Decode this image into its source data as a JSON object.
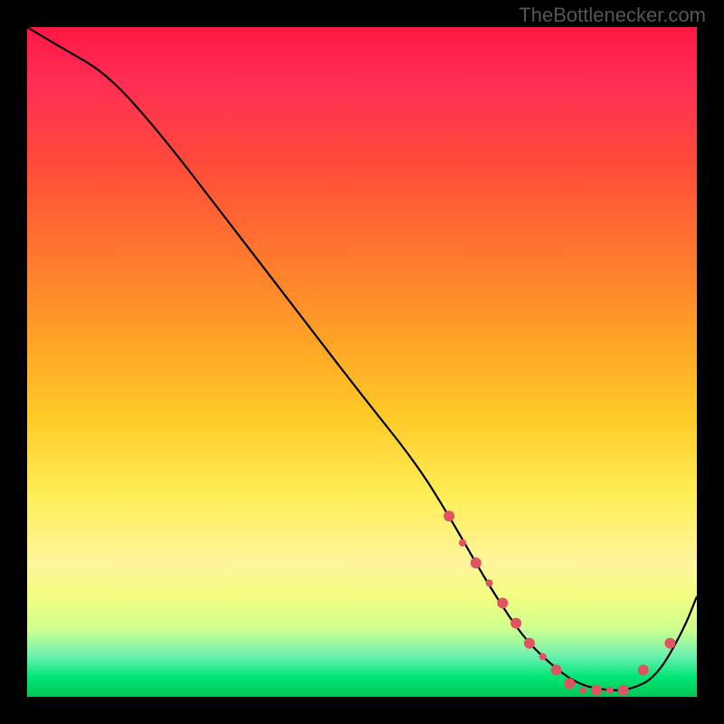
{
  "watermark": "TheBottlenecker.com",
  "chart_data": {
    "type": "line",
    "title": "",
    "xlabel": "",
    "ylabel": "",
    "xlim": [
      0,
      100
    ],
    "ylim": [
      0,
      100
    ],
    "series": [
      {
        "name": "bottleneck-curve",
        "x": [
          0,
          5,
          12,
          20,
          30,
          40,
          50,
          58,
          63,
          67,
          70,
          74,
          78,
          82,
          86,
          90,
          94,
          98,
          100
        ],
        "values": [
          100,
          97,
          93,
          84,
          71,
          58,
          45,
          35,
          27,
          20,
          15,
          9,
          5,
          2,
          1,
          1,
          3,
          10,
          15
        ]
      }
    ],
    "markers": {
      "comment": "clustered points along the valley of the curve",
      "x": [
        63,
        65,
        67,
        69,
        71,
        73,
        75,
        77,
        79,
        81,
        83,
        85,
        87,
        89,
        92,
        96
      ],
      "values": [
        27,
        23,
        20,
        17,
        14,
        11,
        8,
        6,
        4,
        2,
        1,
        1,
        1,
        1,
        4,
        8
      ],
      "color": "#e15361",
      "size": [
        6,
        4,
        6,
        4,
        6,
        6,
        6,
        4,
        6,
        6,
        4,
        6,
        4,
        6,
        6,
        6
      ]
    },
    "gradient_stops": [
      {
        "pos": 0,
        "color": "#ff1744"
      },
      {
        "pos": 50,
        "color": "#ffca28"
      },
      {
        "pos": 80,
        "color": "#fff176"
      },
      {
        "pos": 100,
        "color": "#00c853"
      }
    ]
  }
}
